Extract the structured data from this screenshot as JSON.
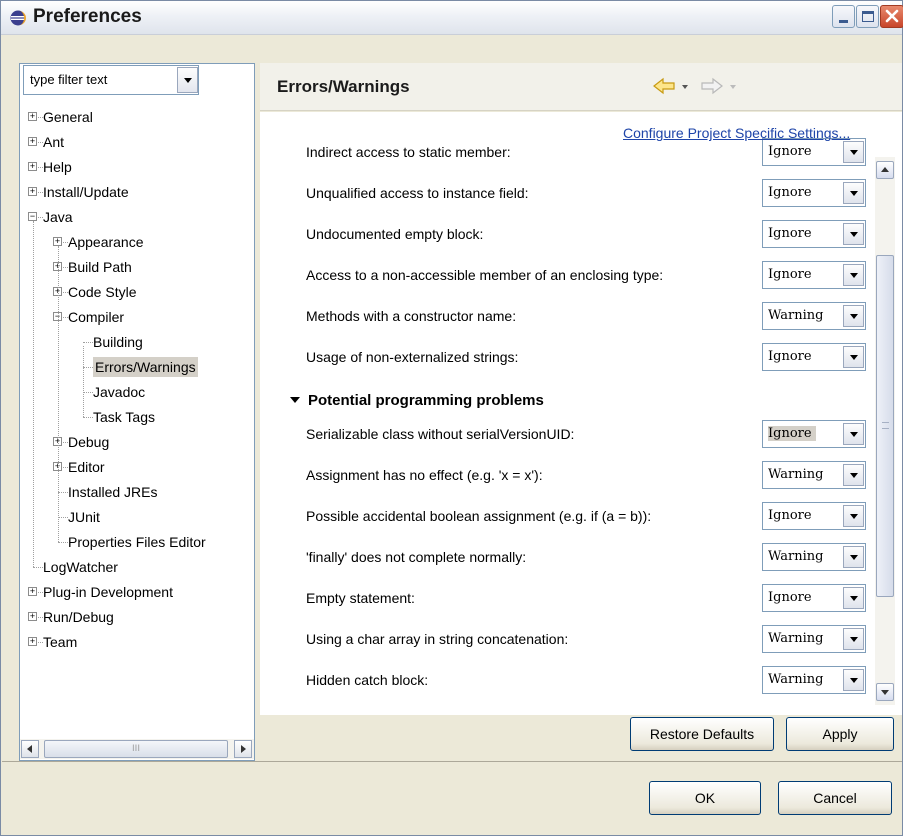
{
  "window": {
    "title": "Preferences",
    "accent": "#0a246a",
    "close_color": "#c8452a"
  },
  "filter": {
    "value": "type filter text"
  },
  "tree": {
    "items": [
      {
        "label": "General",
        "expander": "+"
      },
      {
        "label": "Ant",
        "expander": "+"
      },
      {
        "label": "Help",
        "expander": "+"
      },
      {
        "label": "Install/Update",
        "expander": "+"
      },
      {
        "label": "Java",
        "expander": "−"
      },
      {
        "label": "Appearance",
        "expander": "+"
      },
      {
        "label": "Build Path",
        "expander": "+"
      },
      {
        "label": "Code Style",
        "expander": "+"
      },
      {
        "label": "Compiler",
        "expander": "−"
      },
      {
        "label": "Building"
      },
      {
        "label": "Errors/Warnings",
        "selected": true
      },
      {
        "label": "Javadoc"
      },
      {
        "label": "Task Tags"
      },
      {
        "label": "Debug",
        "expander": "+"
      },
      {
        "label": "Editor",
        "expander": "+"
      },
      {
        "label": "Installed JREs"
      },
      {
        "label": "JUnit"
      },
      {
        "label": "Properties Files Editor"
      },
      {
        "label": "LogWatcher"
      },
      {
        "label": "Plug-in Development",
        "expander": "+"
      },
      {
        "label": "Run/Debug",
        "expander": "+"
      },
      {
        "label": "Team",
        "expander": "+"
      }
    ],
    "scroll_grip": "III"
  },
  "page": {
    "title": "Errors/Warnings",
    "configure_link": "Configure Project Specific Settings...",
    "rows_top": [
      {
        "label": "Indirect access to static member:",
        "value": "Ignore"
      },
      {
        "label": "Unqualified access to instance field:",
        "value": "Ignore"
      },
      {
        "label": "Undocumented empty block:",
        "value": "Ignore"
      },
      {
        "label": "Access to a non-accessible member of an enclosing type:",
        "value": "Ignore"
      },
      {
        "label": "Methods with a constructor name:",
        "value": "Warning"
      },
      {
        "label": "Usage of non-externalized strings:",
        "value": "Ignore"
      }
    ],
    "section_title": "Potential programming problems",
    "rows_section": [
      {
        "label": "Serializable class without serialVersionUID:",
        "value": "Ignore"
      },
      {
        "label": "Assignment has no effect (e.g. 'x = x'):",
        "value": "Warning"
      },
      {
        "label": "Possible accidental boolean assignment (e.g. if (a = b)):",
        "value": "Ignore"
      },
      {
        "label": "'finally' does not complete normally:",
        "value": "Warning"
      },
      {
        "label": "Empty statement:",
        "value": "Ignore"
      },
      {
        "label": "Using a char array in string concatenation:",
        "value": "Warning"
      },
      {
        "label": "Hidden catch block:",
        "value": "Warning"
      }
    ]
  },
  "buttons": {
    "restore_defaults": "Restore Defaults",
    "apply": "Apply",
    "ok": "OK",
    "cancel": "Cancel"
  }
}
